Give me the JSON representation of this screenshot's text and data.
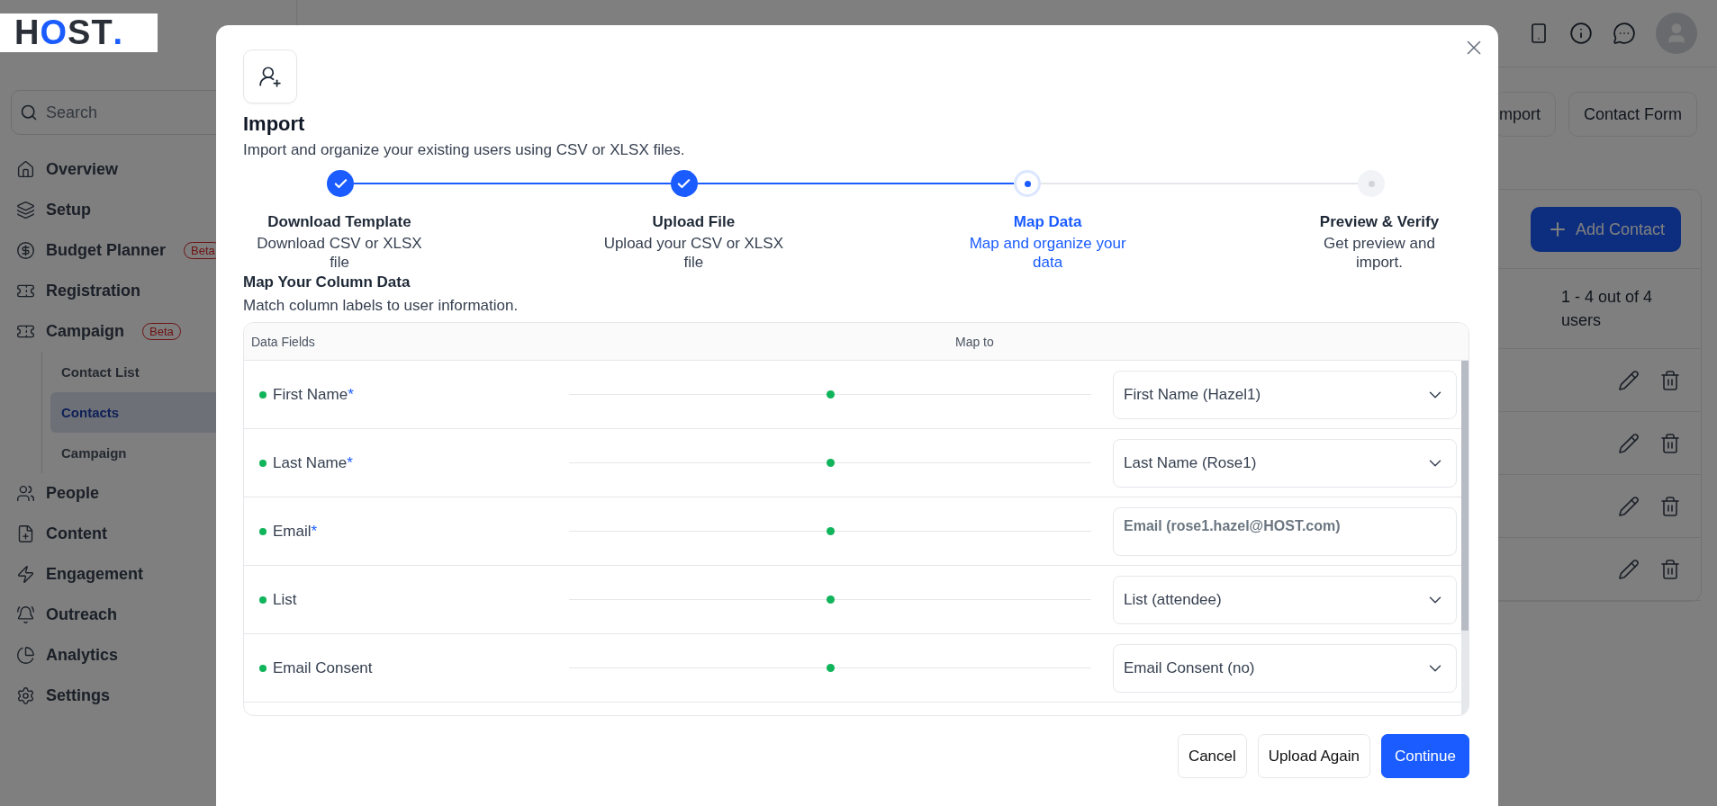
{
  "logo": {
    "text": "HOST."
  },
  "sidebar": {
    "search": {
      "placeholder": "Search"
    },
    "items": [
      {
        "label": "Overview",
        "selected": false
      },
      {
        "label": "Setup",
        "selected": false
      },
      {
        "label": "Budget Planner",
        "badge": "Beta",
        "selected": false
      },
      {
        "label": "Registration",
        "selected": false
      },
      {
        "label": "Campaign",
        "badge": "Beta",
        "selected": false,
        "expanded": true,
        "children": [
          {
            "label": "Contact List",
            "selected": false
          },
          {
            "label": "Contacts",
            "selected": true
          },
          {
            "label": "Campaign",
            "selected": false
          }
        ]
      },
      {
        "label": "People",
        "selected": false
      },
      {
        "label": "Content",
        "selected": false
      },
      {
        "label": "Engagement",
        "selected": false
      },
      {
        "label": "Outreach",
        "selected": false
      },
      {
        "label": "Analytics",
        "selected": false
      },
      {
        "label": "Settings",
        "selected": false
      }
    ]
  },
  "main": {
    "header_buttons": [
      "mport",
      "Contact Form"
    ],
    "add_button": "Add Contact",
    "count": "1 - 4 out of 4 users",
    "rows": [
      {
        "kind": "contact"
      },
      {
        "kind": "contact"
      },
      {
        "kind": "contact"
      },
      {
        "kind": "contact"
      }
    ]
  },
  "modal": {
    "title": "Import",
    "subtitle": "Import and organize your existing users using CSV or XLSX files.",
    "steps": [
      {
        "title": "Download Template",
        "description": "Download CSV or XLSX file",
        "completed": true,
        "selected": false
      },
      {
        "title": "Upload File",
        "description": "Upload your CSV or XLSX file",
        "completed": true,
        "selected": false
      },
      {
        "title": "Map Data",
        "description": "Map and organize your data",
        "completed": false,
        "selected": true
      },
      {
        "title": "Preview & Verify",
        "description": "Get preview and import.",
        "completed": false,
        "selected": false
      }
    ],
    "mapping": {
      "title": "Map Your Column Data",
      "subtitle": "Match column labels to user information.",
      "columns": [
        "Data Fields",
        "Map to"
      ],
      "rows": [
        {
          "label": "First Name*",
          "required": true,
          "value": "First Name (Hazel1)",
          "kind": "dropdown"
        },
        {
          "label": "Last Name*",
          "required": true,
          "value": "Last Name (Rose1)",
          "kind": "dropdown"
        },
        {
          "label": "Email*",
          "required": true,
          "value": "Email (rose1.hazel@HOST.com)",
          "kind": "text"
        },
        {
          "label": "List",
          "required": false,
          "value": "List (attendee)",
          "kind": "dropdown"
        },
        {
          "label": "Email Consent",
          "required": false,
          "value": "Email Consent (no)",
          "kind": "dropdown"
        }
      ]
    },
    "buttons": [
      {
        "label": "Cancel",
        "kind": "secondary"
      },
      {
        "label": "Upload Again",
        "kind": "secondary"
      },
      {
        "label": "Continue",
        "kind": "primary"
      }
    ]
  }
}
